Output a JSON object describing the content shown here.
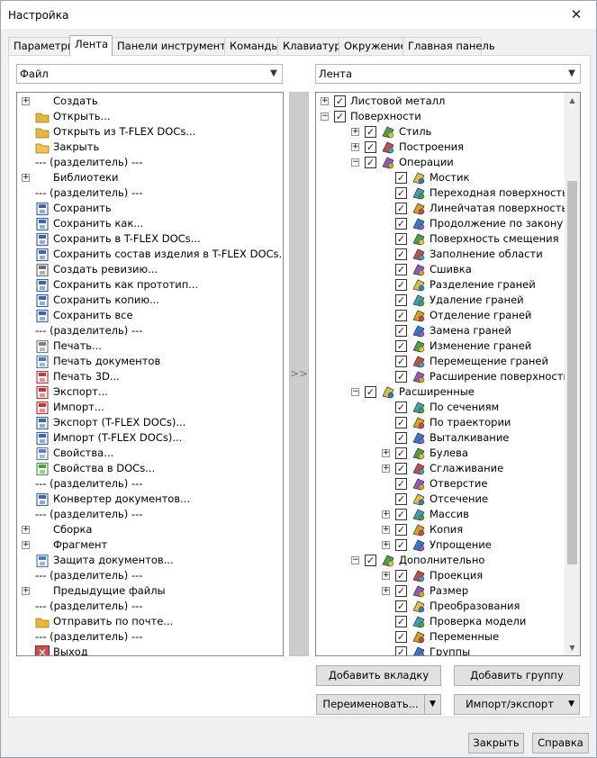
{
  "window": {
    "title": "Настройка",
    "close_glyph": "✕"
  },
  "tabs": [
    "Параметры",
    "Лента",
    "Панели инструментов",
    "Команды",
    "Клавиатура",
    "Окружение",
    "Главная панель"
  ],
  "left_combo": {
    "value": "Файл"
  },
  "right_combo": {
    "value": "Лента"
  },
  "move_button": {
    "label": ">>"
  },
  "left_list": [
    {
      "label": "Создать",
      "expander": true,
      "icon": "none-icon"
    },
    {
      "label": "Открыть...",
      "icon": "open-folder-icon"
    },
    {
      "label": "Открыть из T-FLEX DOCs...",
      "icon": "open-docs-icon"
    },
    {
      "label": "Закрыть",
      "icon": "folder-icon"
    },
    {
      "label": "--- (разделитель) ---",
      "icon": "none-icon"
    },
    {
      "label": "Библиотеки",
      "expander": true,
      "icon": "none-icon"
    },
    {
      "label": "--- (разделитель) ---",
      "icon": "none-icon"
    },
    {
      "label": "Сохранить",
      "icon": "save-icon"
    },
    {
      "label": "Сохранить как...",
      "icon": "save-as-icon"
    },
    {
      "label": "Сохранить в T-FLEX DOCs...",
      "icon": "save-docs-icon"
    },
    {
      "label": "Сохранить состав изделия в T-FLEX DOCs...",
      "icon": "save-structure-icon"
    },
    {
      "label": "Создать ревизию...",
      "icon": "revision-icon"
    },
    {
      "label": "Сохранить как прототип...",
      "icon": "save-prototype-icon"
    },
    {
      "label": "Сохранить копию...",
      "icon": "save-copy-icon"
    },
    {
      "label": "Сохранить все",
      "icon": "save-all-icon"
    },
    {
      "label": "--- (разделитель) ---",
      "icon": "none-icon"
    },
    {
      "label": "Печать...",
      "icon": "print-icon"
    },
    {
      "label": "Печать документов",
      "icon": "print-docs-icon"
    },
    {
      "label": "Печать 3D...",
      "icon": "print-3d-icon"
    },
    {
      "label": "Экспорт...",
      "icon": "export-icon"
    },
    {
      "label": "Импорт...",
      "icon": "import-icon"
    },
    {
      "label": "Экспорт (T-FLEX DOCs)...",
      "icon": "export-docs-icon"
    },
    {
      "label": "Импорт (T-FLEX DOCs)...",
      "icon": "import-docs-icon"
    },
    {
      "label": "Свойства...",
      "icon": "properties-icon"
    },
    {
      "label": "Свойства в DOCs...",
      "icon": "properties-docs-icon"
    },
    {
      "label": "--- (разделитель) ---",
      "icon": "none-icon"
    },
    {
      "label": "Конвертер документов...",
      "icon": "converter-icon"
    },
    {
      "label": "--- (разделитель) ---",
      "icon": "none-icon"
    },
    {
      "label": "Сборка",
      "expander": true,
      "icon": "none-icon"
    },
    {
      "label": "Фрагмент",
      "expander": true,
      "icon": "none-icon"
    },
    {
      "label": "Защита документов...",
      "icon": "protection-icon"
    },
    {
      "label": "--- (разделитель) ---",
      "icon": "none-icon"
    },
    {
      "label": "Предыдущие файлы",
      "expander": true,
      "icon": "none-icon"
    },
    {
      "label": "--- (разделитель) ---",
      "icon": "none-icon"
    },
    {
      "label": "Отправить по почте...",
      "icon": "mail-icon"
    },
    {
      "label": "--- (разделитель) ---",
      "icon": "none-icon"
    },
    {
      "label": "Выход",
      "icon": "exit-icon"
    }
  ],
  "right_tree": [
    {
      "label": "Листовой металл",
      "level": 0,
      "expander": "+",
      "icon": "none-icon"
    },
    {
      "label": "Поверхности",
      "level": 0,
      "expander": "−",
      "icon": "none-icon"
    },
    {
      "label": "Стиль",
      "level": 1,
      "expander": "+",
      "icon": "style-icon"
    },
    {
      "label": "Построения",
      "level": 1,
      "expander": "+",
      "icon": "construction-icon"
    },
    {
      "label": "Операции",
      "level": 1,
      "expander": "−",
      "icon": "operations-icon"
    },
    {
      "label": "Мостик",
      "level": 2,
      "icon": "bridge-icon"
    },
    {
      "label": "Переходная поверхность",
      "level": 2,
      "icon": "transition-surface-icon"
    },
    {
      "label": "Линейчатая поверхность",
      "level": 2,
      "icon": "ruled-surface-icon"
    },
    {
      "label": "Продолжение по закону",
      "level": 2,
      "icon": "extension-law-icon"
    },
    {
      "label": "Поверхность смещения",
      "level": 2,
      "icon": "offset-surface-icon"
    },
    {
      "label": "Заполнение области",
      "level": 2,
      "icon": "fill-region-icon"
    },
    {
      "label": "Сшивка",
      "level": 2,
      "icon": "stitch-icon"
    },
    {
      "label": "Разделение граней",
      "level": 2,
      "icon": "split-faces-icon"
    },
    {
      "label": "Удаление граней",
      "level": 2,
      "icon": "delete-faces-icon"
    },
    {
      "label": "Отделение граней",
      "level": 2,
      "icon": "detach-faces-icon"
    },
    {
      "label": "Замена граней",
      "level": 2,
      "icon": "replace-faces-icon"
    },
    {
      "label": "Изменение граней",
      "level": 2,
      "icon": "modify-faces-icon"
    },
    {
      "label": "Перемещение граней",
      "level": 2,
      "icon": "move-faces-icon"
    },
    {
      "label": "Расширение поверхности",
      "level": 2,
      "icon": "extend-surface-icon"
    },
    {
      "label": "Расширенные",
      "level": 1,
      "expander": "−",
      "icon": "advanced-icon"
    },
    {
      "label": "По сечениям",
      "level": 2,
      "icon": "loft-icon"
    },
    {
      "label": "По траектории",
      "level": 2,
      "icon": "sweep-icon"
    },
    {
      "label": "Выталкивание",
      "level": 2,
      "icon": "extrude-icon"
    },
    {
      "label": "Булева",
      "level": 2,
      "expander": "+",
      "icon": "boolean-icon"
    },
    {
      "label": "Сглаживание",
      "level": 2,
      "expander": "+",
      "icon": "smoothing-icon"
    },
    {
      "label": "Отверстие",
      "level": 2,
      "icon": "hole-icon"
    },
    {
      "label": "Отсечение",
      "level": 2,
      "icon": "cut-icon"
    },
    {
      "label": "Массив",
      "level": 2,
      "expander": "+",
      "icon": "pattern-icon"
    },
    {
      "label": "Копия",
      "level": 2,
      "expander": "+",
      "icon": "copy-icon"
    },
    {
      "label": "Упрощение",
      "level": 2,
      "expander": "+",
      "icon": "simplify-icon"
    },
    {
      "label": "Дополнительно",
      "level": 1,
      "expander": "−",
      "icon": "additional-icon"
    },
    {
      "label": "Проекция",
      "level": 2,
      "expander": "+",
      "icon": "projection-icon"
    },
    {
      "label": "Размер",
      "level": 2,
      "expander": "+",
      "icon": "dimension-icon"
    },
    {
      "label": "Преобразования",
      "level": 2,
      "icon": "transform-icon"
    },
    {
      "label": "Проверка модели",
      "level": 2,
      "icon": "check-model-icon"
    },
    {
      "label": "Переменные",
      "level": 2,
      "icon": "variables-icon"
    },
    {
      "label": "Группы",
      "level": 2,
      "icon": "groups-icon"
    }
  ],
  "buttons": {
    "add_tab": "Добавить вкладку",
    "add_group": "Добавить группу",
    "rename": "Переименовать...",
    "import_export": "Импорт/экспорт",
    "close": "Закрыть",
    "help": "Справка"
  }
}
